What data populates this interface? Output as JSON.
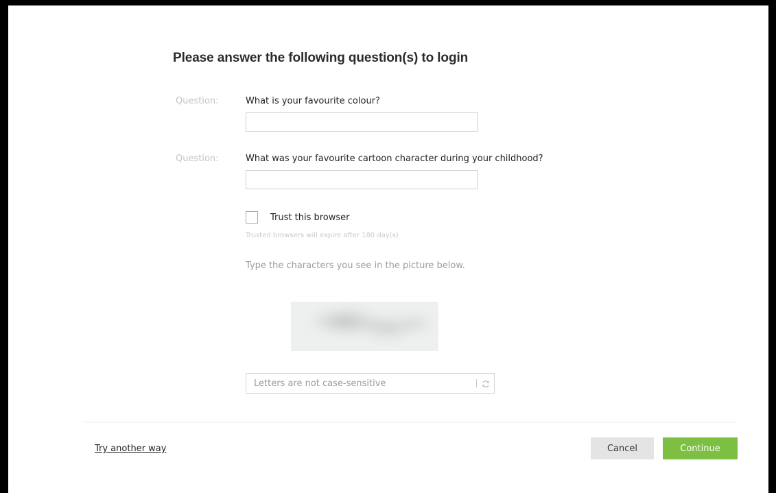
{
  "form": {
    "title": "Please answer the following question(s) to login",
    "questions": [
      {
        "label": "Question:",
        "text": "What is your favourite colour?",
        "answer": ""
      },
      {
        "label": "Question:",
        "text": "What was your favourite cartoon character during your childhood?",
        "answer": ""
      }
    ],
    "trust": {
      "label": "Trust this browser",
      "hint": "Trusted browsers will expire after 180 day(s)",
      "checked": false
    },
    "captcha": {
      "instruction": "Type the characters you see in the picture below.",
      "placeholder": "Letters are not case-sensitive",
      "value": "",
      "refresh_icon": "refresh-icon"
    }
  },
  "footer": {
    "alt_link": "Try another way",
    "cancel_label": "Cancel",
    "continue_label": "Continue"
  },
  "colors": {
    "primary_button": "#7cbf42",
    "secondary_button": "#e4e4e4",
    "muted_text": "#c4c4c4"
  }
}
